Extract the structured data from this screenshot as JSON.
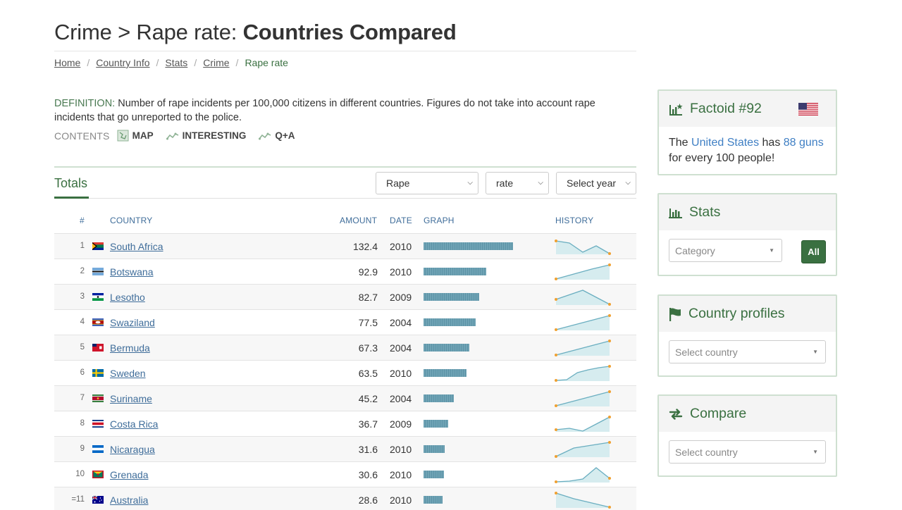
{
  "header": {
    "title_prefix": "Crime > Rape rate: ",
    "title_bold": "Countries Compared"
  },
  "breadcrumb": [
    "Home",
    "Country Info",
    "Stats",
    "Crime",
    "Rape rate"
  ],
  "definition": {
    "label": "DEFINITION:",
    "text": " Number of rape incidents per 100,000 citizens in different countries. Figures do not take into account rape incidents that go unreported to the police."
  },
  "contents": {
    "label": "CONTENTS",
    "items": [
      "MAP",
      "INTERESTING",
      "Q+A"
    ]
  },
  "totals": {
    "tab_label": "Totals",
    "selects": [
      "Rape",
      "rate",
      "Select year"
    ]
  },
  "table": {
    "headers": {
      "rank": "#",
      "country": "COUNTRY",
      "amount": "AMOUNT",
      "date": "DATE",
      "graph": "GRAPH",
      "history": "HISTORY"
    },
    "max_value": 132.4,
    "rows": [
      {
        "rank": "1",
        "country": "South Africa",
        "amount": "132.4",
        "value": 132.4,
        "date": "2010",
        "history": [
          0.9,
          0.75,
          0.1,
          0.55,
          0.0
        ]
      },
      {
        "rank": "2",
        "country": "Botswana",
        "amount": "92.9",
        "value": 92.9,
        "date": "2010",
        "history": [
          0.0,
          0.35,
          0.7,
          1.0
        ]
      },
      {
        "rank": "3",
        "country": "Lesotho",
        "amount": "82.7",
        "value": 82.7,
        "date": "2009",
        "history": [
          0.35,
          1.0,
          0.0
        ]
      },
      {
        "rank": "4",
        "country": "Swaziland",
        "amount": "77.5",
        "value": 77.5,
        "date": "2004",
        "history": [
          0.0,
          0.5,
          1.0
        ]
      },
      {
        "rank": "5",
        "country": "Bermuda",
        "amount": "67.3",
        "value": 67.3,
        "date": "2004",
        "history": [
          0.0,
          0.5,
          1.0
        ]
      },
      {
        "rank": "6",
        "country": "Sweden",
        "amount": "63.5",
        "value": 63.5,
        "date": "2010",
        "history": [
          0.0,
          0.05,
          0.55,
          0.75,
          0.9,
          1.0
        ]
      },
      {
        "rank": "7",
        "country": "Suriname",
        "amount": "45.2",
        "value": 45.2,
        "date": "2004",
        "history": [
          0.0,
          0.5,
          1.0
        ]
      },
      {
        "rank": "8",
        "country": "Costa Rica",
        "amount": "36.7",
        "value": 36.7,
        "date": "2009",
        "history": [
          0.1,
          0.2,
          0.0,
          0.5,
          1.0
        ]
      },
      {
        "rank": "9",
        "country": "Nicaragua",
        "amount": "31.6",
        "value": 31.6,
        "date": "2010",
        "history": [
          0.0,
          0.6,
          0.8,
          1.0
        ]
      },
      {
        "rank": "10",
        "country": "Grenada",
        "amount": "30.6",
        "value": 30.6,
        "date": "2010",
        "history": [
          0.0,
          0.05,
          0.2,
          1.0,
          0.25
        ]
      },
      {
        "rank": "=11",
        "country": "Australia",
        "amount": "28.6",
        "value": 28.6,
        "date": "2010",
        "history": [
          1.0,
          0.6,
          0.3,
          0.0
        ]
      }
    ]
  },
  "sidebar": {
    "factoid": {
      "title": "Factoid #92",
      "text_1": "The ",
      "link_country": "United States",
      "text_2": " has ",
      "link_value": "88 guns",
      "text_3": " for every 100 people!"
    },
    "stats": {
      "title": "Stats",
      "category_placeholder": "Category",
      "all_label": "All"
    },
    "country_profiles": {
      "title": "Country profiles",
      "placeholder": "Select country"
    },
    "compare": {
      "title": "Compare",
      "placeholder": "Select country"
    }
  },
  "colors": {
    "brand_green": "#3a7041",
    "link_blue": "#3f6d9a",
    "bar": "#6fa3b5"
  }
}
